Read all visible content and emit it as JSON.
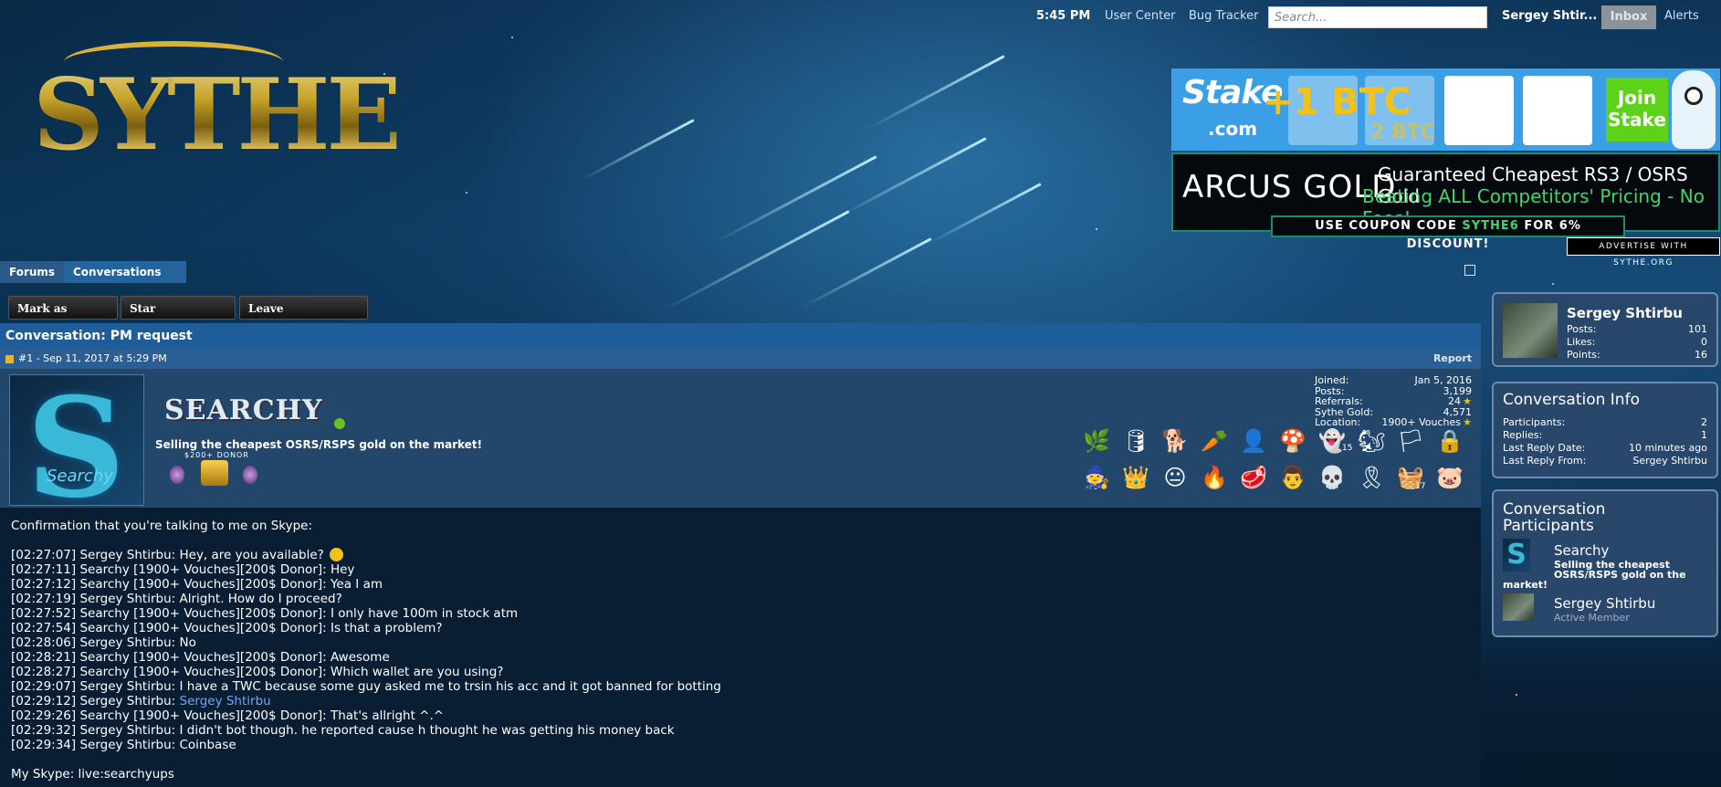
{
  "topbar": {
    "time": "5:45 PM",
    "user_center": "User Center",
    "bug_tracker": "Bug Tracker",
    "search_placeholder": "Search...",
    "username": "Sergey Shtir...",
    "inbox": "Inbox",
    "alerts": "Alerts"
  },
  "logo": {
    "text": "SYTHE"
  },
  "ads": {
    "stake": {
      "brand": "Stake",
      "domain": ".com",
      "btc": "+1 BTC",
      "btc2": "2 BTC",
      "join": "Join Stake"
    },
    "arcus": {
      "brand": "ARCUS GOLD",
      "line1": "Guaranteed Cheapest RS3 / OSRS Gold",
      "line2": "Beating ALL Competitors' Pricing - No Fees!"
    },
    "coupon": {
      "prefix": "USE COUPON CODE ",
      "code": "SYTHE6",
      "suffix": " FOR 6% DISCOUNT!"
    },
    "advertise": "ADVERTISE WITH SYTHE.ORG"
  },
  "breadcrumb": {
    "forums": "Forums",
    "conversations": "Conversations"
  },
  "actions": {
    "mark_unread": "Mark as Unread",
    "star": "Star Conversation",
    "leave": "Leave Conversation"
  },
  "conversation": {
    "title": "Conversation: PM request",
    "message_meta": "#1 - Sep 11, 2017 at 5:29 PM",
    "report": "Report"
  },
  "poster": {
    "banner": "SEARCHY",
    "avatar_letter": "S",
    "avatar_sub": "Searchy",
    "title": "Selling the cheapest OSRS/RSPS gold on the market!",
    "donor": "$200+ DONOR",
    "stats": [
      {
        "k": "Joined:",
        "v": "Jan 5, 2016"
      },
      {
        "k": "Posts:",
        "v": "3,199"
      },
      {
        "k": "Referrals:",
        "v": "24"
      },
      {
        "k": "Sythe Gold:",
        "v": "4,571"
      },
      {
        "k": "Location:",
        "v": "1900+ Vouches"
      }
    ],
    "trophy_counts": {
      "ghost": "15",
      "basket": "17"
    },
    "trophies_row1": [
      "🌿",
      "🛢",
      "🐕",
      "🥕",
      "👤",
      "🍄",
      "👻",
      "🐿",
      "🏳",
      "🔒"
    ],
    "trophies_row2": [
      "🧙",
      "👑",
      "😐",
      "🔥",
      "🥩",
      "👨",
      "💀",
      "🎗",
      "🧺",
      "🐷"
    ]
  },
  "message": {
    "intro": "Confirmation that you're talking to me on Skype:",
    "lines": [
      "[02:27:07] Sergey Shtirbu: Hey, are you available?",
      "[02:27:11] Searchy [1900+ Vouches][200$ Donor]: Hey",
      "[02:27:12] Searchy [1900+ Vouches][200$ Donor]: Yea I am",
      "[02:27:19] Sergey Shtirbu: Alright. How do I proceed?",
      "[02:27:52] Searchy [1900+ Vouches][200$ Donor]: I only have 100m in stock atm",
      "[02:27:54] Searchy [1900+ Vouches][200$ Donor]: Is that a problem?",
      "[02:28:06] Sergey Shtirbu: No",
      "[02:28:21] Searchy [1900+ Vouches][200$ Donor]: Awesome",
      "[02:28:27] Searchy [1900+ Vouches][200$ Donor]: Which wallet are you using?",
      "[02:29:07] Sergey Shtirbu: I have a TWC because some guy asked me to trsin his acc and it got banned for botting",
      "[02:29:12] Sergey Shtirbu: ",
      "[02:29:26] Searchy [1900+ Vouches][200$ Donor]: That's allright ^.^",
      "[02:29:32] Sergey Shtirbu: I didn't bot though. he reported cause h thought he was getting his money back",
      "[02:29:34] Sergey Shtirbu: Coinbase"
    ],
    "mention": "Sergey Shtirbu",
    "skype": "My Skype: live:searchyups"
  },
  "sidebar": {
    "me": {
      "name": "Sergey Shtirbu",
      "stats": [
        {
          "k": "Posts:",
          "v": "101"
        },
        {
          "k": "Likes:",
          "v": "0"
        },
        {
          "k": "Points:",
          "v": "16"
        }
      ]
    },
    "info": {
      "title": "Conversation Info",
      "rows": [
        {
          "k": "Participants:",
          "v": "2"
        },
        {
          "k": "Replies:",
          "v": "1"
        },
        {
          "k": "Last Reply Date:",
          "v": "10 minutes ago"
        },
        {
          "k": "Last Reply From:",
          "v": "Sergey Shtirbu"
        }
      ]
    },
    "participants": {
      "title_1": "Conversation",
      "title_2": "Participants",
      "p1": {
        "name": "Searchy",
        "title_a": "Selling the cheapest",
        "title_b": "OSRS/RSPS gold on the",
        "title_c": "market!"
      },
      "p2": {
        "name": "Sergey Shtirbu",
        "title": "Active Member"
      }
    }
  }
}
